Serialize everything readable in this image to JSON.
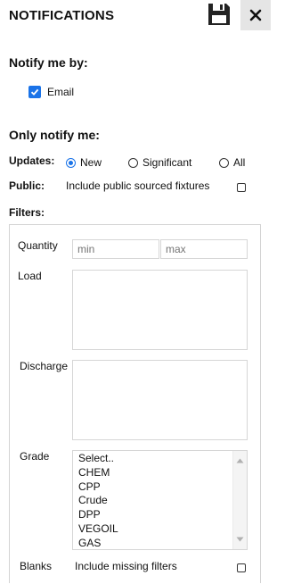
{
  "header": {
    "title": "NOTIFICATIONS",
    "save_icon": "floppy-disk-icon",
    "close_icon": "close-icon"
  },
  "notify_by": {
    "heading": "Notify me by:",
    "email": {
      "label": "Email",
      "checked": true
    }
  },
  "only_notify": {
    "heading": "Only notify me:",
    "updates": {
      "label": "Updates:",
      "options": [
        "New",
        "Significant",
        "All"
      ],
      "selected": "New"
    },
    "public": {
      "label": "Public:",
      "text": "Include public sourced fixtures",
      "checked": false
    }
  },
  "filters": {
    "heading": "Filters:",
    "quantity": {
      "label": "Quantity",
      "min_placeholder": "min",
      "max_placeholder": "max"
    },
    "load": {
      "label": "Load"
    },
    "discharge": {
      "label": "Discharge"
    },
    "grade": {
      "label": "Grade",
      "options": [
        "Select..",
        "CHEM",
        "CPP",
        "Crude",
        "DPP",
        "VEGOIL",
        "GAS"
      ]
    },
    "blanks": {
      "label": "Blanks",
      "text": "Include missing filters",
      "checked": false
    }
  },
  "colors": {
    "accent": "#1a73e8",
    "close_bg": "#e5e5e5",
    "border": "#d4d4d4"
  }
}
